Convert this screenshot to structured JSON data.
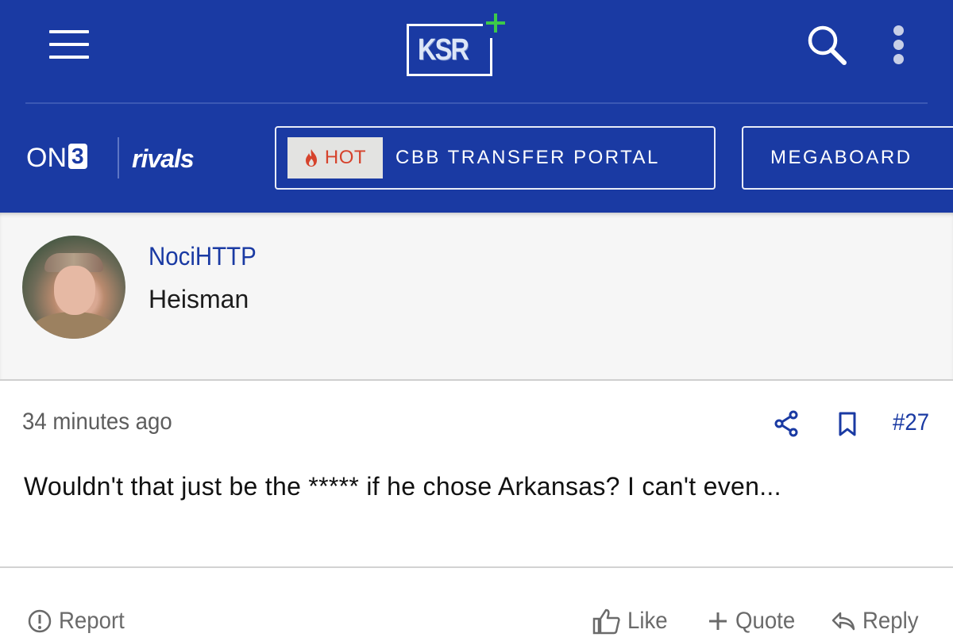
{
  "header": {
    "logo_text": "KSR",
    "brand_on3": "ON",
    "brand_on3_digit": "3",
    "brand_rivals": "rivals",
    "hot_label": "HOT",
    "portal_label": "CBB TRANSFER PORTAL",
    "megaboard_label": "MEGABOARD"
  },
  "user": {
    "name": "NociHTTP",
    "title": "Heisman"
  },
  "post": {
    "timestamp": "34 minutes ago",
    "number": "#27",
    "body": "Wouldn't that just be the ***** if he chose Arkansas? I can't even..."
  },
  "actions": {
    "report": "Report",
    "like": "Like",
    "quote": "Quote",
    "reply": "Reply"
  },
  "colors": {
    "header_bg": "#1a3aa3",
    "accent_green": "#3cc94a",
    "hot_red": "#d6432c",
    "link_blue": "#1a3aa3"
  },
  "icons": [
    "menu-icon",
    "search-icon",
    "more-vertical-icon",
    "flame-icon",
    "share-icon",
    "bookmark-icon",
    "report-icon",
    "like-icon",
    "quote-icon",
    "reply-icon"
  ]
}
